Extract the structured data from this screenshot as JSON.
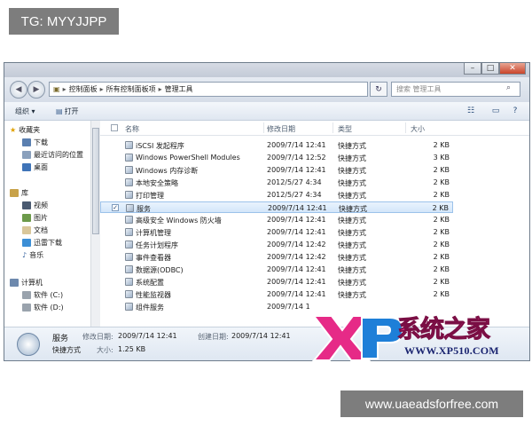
{
  "watermarks": {
    "top_left": "TG: MYYJJPP",
    "bottom_right": "www.uaeadsforfree.com",
    "logo_text": "系统之家",
    "logo_url": "WWW.XP510.COM"
  },
  "address": {
    "breadcrumbs": [
      "控制面板",
      "所有控制面板项",
      "管理工具"
    ],
    "search_placeholder": "搜索 管理工具"
  },
  "toolbar": {
    "organize": "组织 ▾",
    "open": "打开"
  },
  "sidebar": {
    "favorites": "收藏夹",
    "downloads": "下载",
    "recent": "最近访问的位置",
    "desktop": "桌面",
    "libraries": "库",
    "videos": "视频",
    "pictures": "图片",
    "documents": "文档",
    "xunlei": "迅雷下载",
    "music": "音乐",
    "computer": "计算机",
    "drive_c": "软件 (C:)",
    "drive_d": "软件 (D:)"
  },
  "columns": {
    "name": "名称",
    "modified": "修改日期",
    "type": "类型",
    "size": "大小"
  },
  "files": [
    {
      "name": "iSCSI 发起程序",
      "date": "2009/7/14 12:41",
      "type": "快捷方式",
      "size": "2 KB"
    },
    {
      "name": "Windows PowerShell Modules",
      "date": "2009/7/14 12:52",
      "type": "快捷方式",
      "size": "3 KB"
    },
    {
      "name": "Windows 内存诊断",
      "date": "2009/7/14 12:41",
      "type": "快捷方式",
      "size": "2 KB"
    },
    {
      "name": "本地安全策略",
      "date": "2012/5/27 4:34",
      "type": "快捷方式",
      "size": "2 KB"
    },
    {
      "name": "打印管理",
      "date": "2012/5/27 4:34",
      "type": "快捷方式",
      "size": "2 KB"
    },
    {
      "name": "服务",
      "date": "2009/7/14 12:41",
      "type": "快捷方式",
      "size": "2 KB"
    },
    {
      "name": "高级安全 Windows 防火墙",
      "date": "2009/7/14 12:41",
      "type": "快捷方式",
      "size": "2 KB"
    },
    {
      "name": "计算机管理",
      "date": "2009/7/14 12:41",
      "type": "快捷方式",
      "size": "2 KB"
    },
    {
      "name": "任务计划程序",
      "date": "2009/7/14 12:42",
      "type": "快捷方式",
      "size": "2 KB"
    },
    {
      "name": "事件查看器",
      "date": "2009/7/14 12:42",
      "type": "快捷方式",
      "size": "2 KB"
    },
    {
      "name": "数据源(ODBC)",
      "date": "2009/7/14 12:41",
      "type": "快捷方式",
      "size": "2 KB"
    },
    {
      "name": "系统配置",
      "date": "2009/7/14 12:41",
      "type": "快捷方式",
      "size": "2 KB"
    },
    {
      "name": "性能监视器",
      "date": "2009/7/14 12:41",
      "type": "快捷方式",
      "size": "2 KB"
    },
    {
      "name": "组件服务",
      "date": "2009/7/14 1",
      "type": "",
      "size": ""
    }
  ],
  "details": {
    "name": "服务",
    "type": "快捷方式",
    "modified_label": "修改日期:",
    "modified_value": "2009/7/14 12:41",
    "created_label": "创建日期:",
    "created_value": "2009/7/14 12:41",
    "size_label": "大小:",
    "size_value": "1.25 KB"
  },
  "colors": {
    "selection": "#d3e6fa",
    "logo_pink": "#e62a87",
    "logo_blue": "#1e7fd8"
  }
}
